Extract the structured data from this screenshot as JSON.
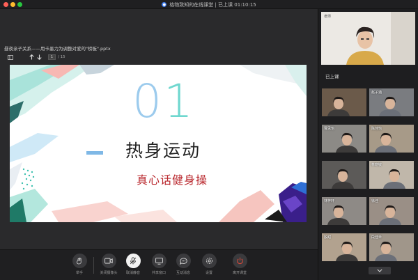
{
  "window": {
    "title": "格物致知的在线课堂 | 已上课 01:10:15",
    "traffic_lights": [
      "#fe5f57",
      "#febc2e",
      "#28c840"
    ]
  },
  "document": {
    "filename": "昼夜亲子关系——用卡墨力为调整对爱的\"榜板\".pptx",
    "page_current": "1",
    "page_total": "/ 15"
  },
  "slide": {
    "number_first": "0",
    "number_second": "1",
    "heading": "热身运动",
    "subheading": "真心话健身操"
  },
  "controls": [
    {
      "name": "hand-raise-button",
      "icon": "hand-icon",
      "label": "举手"
    },
    {
      "name": "camera-button",
      "icon": "camera-icon",
      "label": "关闭摄像头"
    },
    {
      "name": "mic-button",
      "icon": "mic-muted-icon",
      "label": "取消静音"
    },
    {
      "name": "share-screen-button",
      "icon": "screen-share-icon",
      "label": "共享窗口"
    },
    {
      "name": "chat-button",
      "icon": "chat-icon",
      "label": "互动消息"
    },
    {
      "name": "settings-button",
      "icon": "gear-icon",
      "label": "设置"
    },
    {
      "name": "leave-button",
      "icon": "power-icon",
      "label": "离开课堂"
    }
  ],
  "participants": {
    "teacher_name": "老师",
    "joined_label": "已上课",
    "students": [
      {
        "name": "",
        "bg": "#6b5a4a"
      },
      {
        "name": "赵子涵",
        "bg": "#7a7c80"
      },
      {
        "name": "曹思怡",
        "bg": "#8c8a86"
      },
      {
        "name": "陈佳怡",
        "bg": "#a79a88"
      },
      {
        "name": "",
        "bg": "#5c5a58"
      },
      {
        "name": "林晓敏",
        "bg": "#c0b7aa"
      },
      {
        "name": "林梓轩",
        "bg": "#8e8a86"
      },
      {
        "name": "徐佳",
        "bg": "#9a8f86"
      },
      {
        "name": "殷甜",
        "bg": "#b2a28f"
      },
      {
        "name": "段佳禾",
        "bg": "#a0968a"
      }
    ]
  }
}
